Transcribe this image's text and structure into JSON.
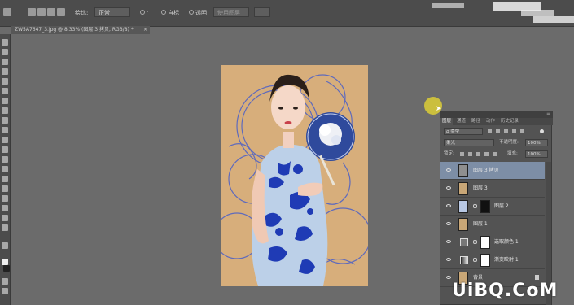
{
  "options_bar": {
    "opacity_label": "绘比:",
    "blend_mode_value": "正常",
    "radio_auto": "自标",
    "radio_transparent": "透明",
    "disabled_button": "使用图层"
  },
  "document": {
    "tab_title": "ZW5A7647_3.jpg @ 8.33% (图层 3 拷贝, RGB/8) *",
    "close": "×"
  },
  "panel": {
    "tabs": [
      "图层",
      "通道",
      "路径",
      "动作",
      "历史记录"
    ],
    "active_tab": "图层",
    "filter_kind": "ρ 类型",
    "blend_mode": "柔光",
    "opacity_label": "不透明度:",
    "opacity_value": "100%",
    "lock_label": "锁定:",
    "fill_label": "填充:",
    "fill_value": "100%",
    "layers": [
      {
        "name": "图层 3 拷贝",
        "selected": true,
        "type": "pixel"
      },
      {
        "name": "图层 3",
        "selected": false,
        "type": "pixel"
      },
      {
        "name": "图层 2",
        "selected": false,
        "type": "masked"
      },
      {
        "name": "图层 1",
        "selected": false,
        "type": "pixel"
      },
      {
        "name": "选取颜色 1",
        "selected": false,
        "type": "adjustment"
      },
      {
        "name": "渐变映射 1",
        "selected": false,
        "type": "adjustment"
      },
      {
        "name": "背景",
        "selected": false,
        "type": "background"
      }
    ]
  },
  "watermark": "UiBQ.CoM",
  "colors": {
    "app_bg": "#6b6b6b",
    "panel_bg": "#535353",
    "selected_layer": "#7d8ea6",
    "photo_bg": "#d9b27f",
    "porcelain_blue": "#2a3fb0",
    "cursor_highlight": "#d6c93a"
  }
}
